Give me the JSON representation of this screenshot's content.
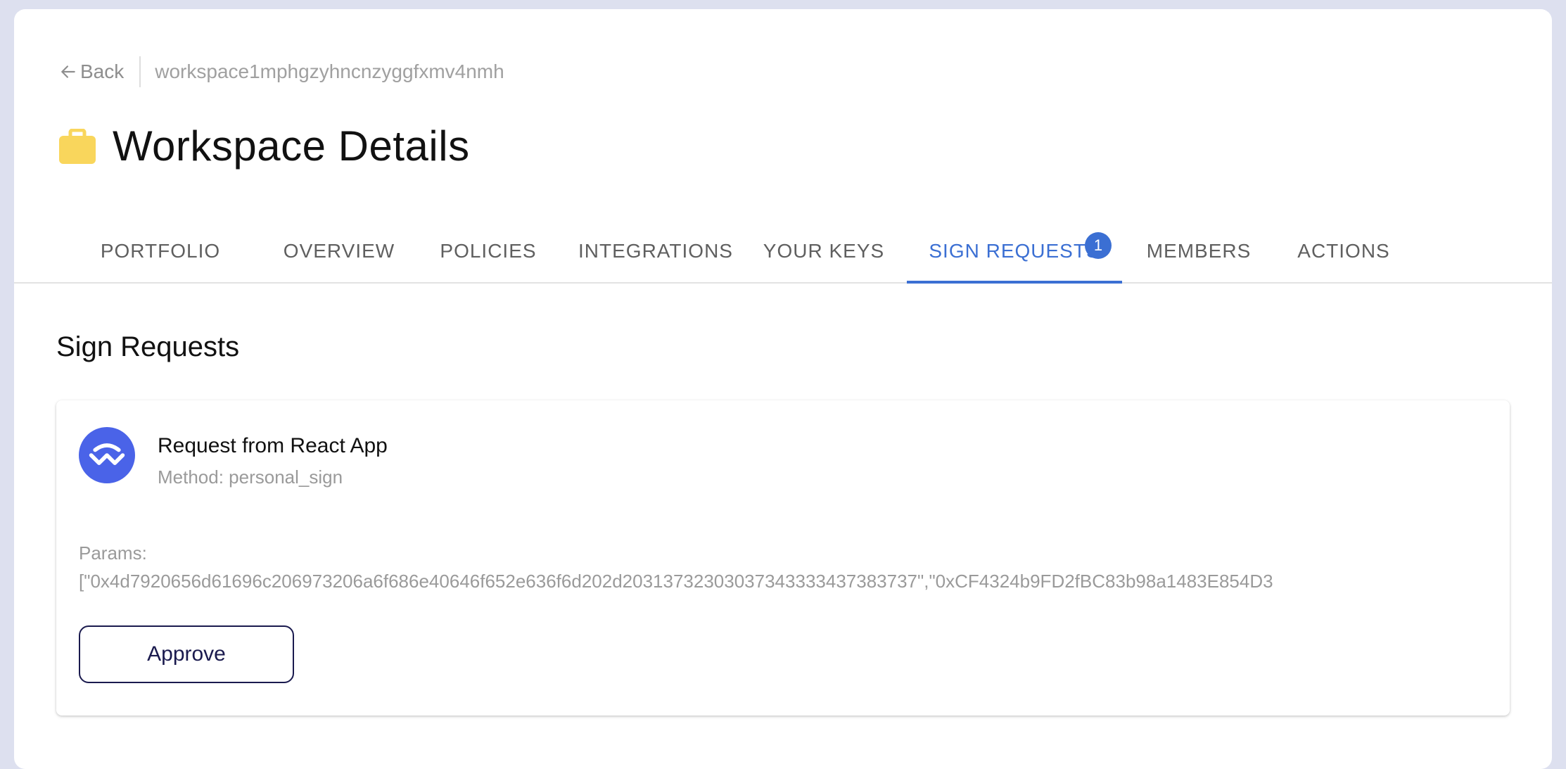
{
  "header": {
    "back_label": "Back",
    "workspace_id": "workspace1mphgzyhncnzyggfxmv4nmh",
    "title": "Workspace Details",
    "title_icon": "briefcase-icon"
  },
  "tabs": [
    {
      "label": "PORTFOLIO",
      "active": false
    },
    {
      "label": "OVERVIEW",
      "active": false
    },
    {
      "label": "POLICIES",
      "active": false
    },
    {
      "label": "INTEGRATIONS",
      "active": false
    },
    {
      "label": "YOUR KEYS",
      "active": false
    },
    {
      "label": "SIGN REQUESTS",
      "active": true,
      "badge": "1"
    },
    {
      "label": "MEMBERS",
      "active": false
    },
    {
      "label": "ACTIONS",
      "active": false
    }
  ],
  "main": {
    "section_title": "Sign Requests",
    "request": {
      "icon": "walletconnect-icon",
      "title": "Request from React App",
      "method": "Method: personal_sign",
      "params_label": "Params:",
      "params_value": "[\"0x4d7920656d61696c206973206a6f686e40646f652e636f6d202d20313732303037343333437383737\",\"0xCF4324b9FD2fBC83b98a1483E854D3",
      "approve_label": "Approve"
    }
  },
  "colors": {
    "accent": "#3b6fd3",
    "background": "#dde0ef",
    "briefcase": "#f9d65c",
    "walletconnect": "#4a63e8",
    "button_border": "#1a1a4e"
  }
}
